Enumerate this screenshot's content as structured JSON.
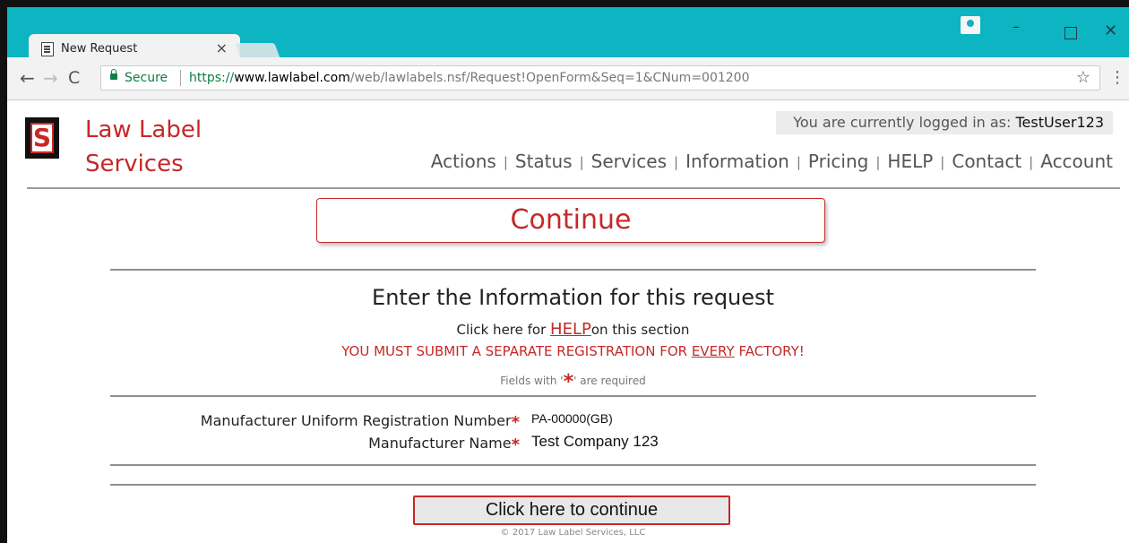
{
  "browser": {
    "tab_title": "New Request",
    "tab_close": "×",
    "secure_label": "Secure",
    "url_scheme": "https://",
    "url_host": "www.lawlabel.com",
    "url_path": "/web/lawlabels.nsf/Request!OpenForm&Seq=1&CNum=001200",
    "icons": {
      "back": "arrow-left-icon",
      "forward": "arrow-right-icon",
      "reload": "reload-icon",
      "lock": "lock-icon",
      "star": "star-icon",
      "menu": "kebab-menu-icon",
      "user": "user-icon",
      "minimize": "minimize-icon",
      "maximize": "maximize-icon",
      "close": "close-icon"
    },
    "accent_color": "#0db4c2"
  },
  "site": {
    "logo_letter": "S",
    "brand_line1": "Law Label",
    "brand_line2": "Services",
    "brand_color": "#c62828",
    "login_prefix": "You are currently logged in as: ",
    "login_user": "TestUser123",
    "nav": [
      {
        "label": "Actions"
      },
      {
        "label": "Status"
      },
      {
        "label": "Services"
      },
      {
        "label": "Information"
      },
      {
        "label": "Pricing"
      },
      {
        "label": "HELP"
      },
      {
        "label": "Contact"
      },
      {
        "label": "Account"
      }
    ],
    "nav_separator": "|"
  },
  "main": {
    "continue_top": "Continue",
    "section_title": "Enter the Information for this request",
    "help_prefix": "Click here for ",
    "help_link": "HELP",
    "help_suffix": "on this section",
    "warning_prefix": "YOU MUST SUBMIT A SEPARATE REGISTRATION FOR ",
    "warning_emph": "EVERY",
    "warning_suffix": " FACTORY!",
    "required_prefix": "Fields with '",
    "required_star": "*",
    "required_suffix": "' are required",
    "fields": [
      {
        "label": "Manufacturer Uniform Registration Number",
        "value": "PA-00000(GB)"
      },
      {
        "label": "Manufacturer Name",
        "value": "Test Company 123"
      }
    ],
    "continue_button": "Click here to continue",
    "copyright": "© 2017 Law Label Services, LLC"
  }
}
